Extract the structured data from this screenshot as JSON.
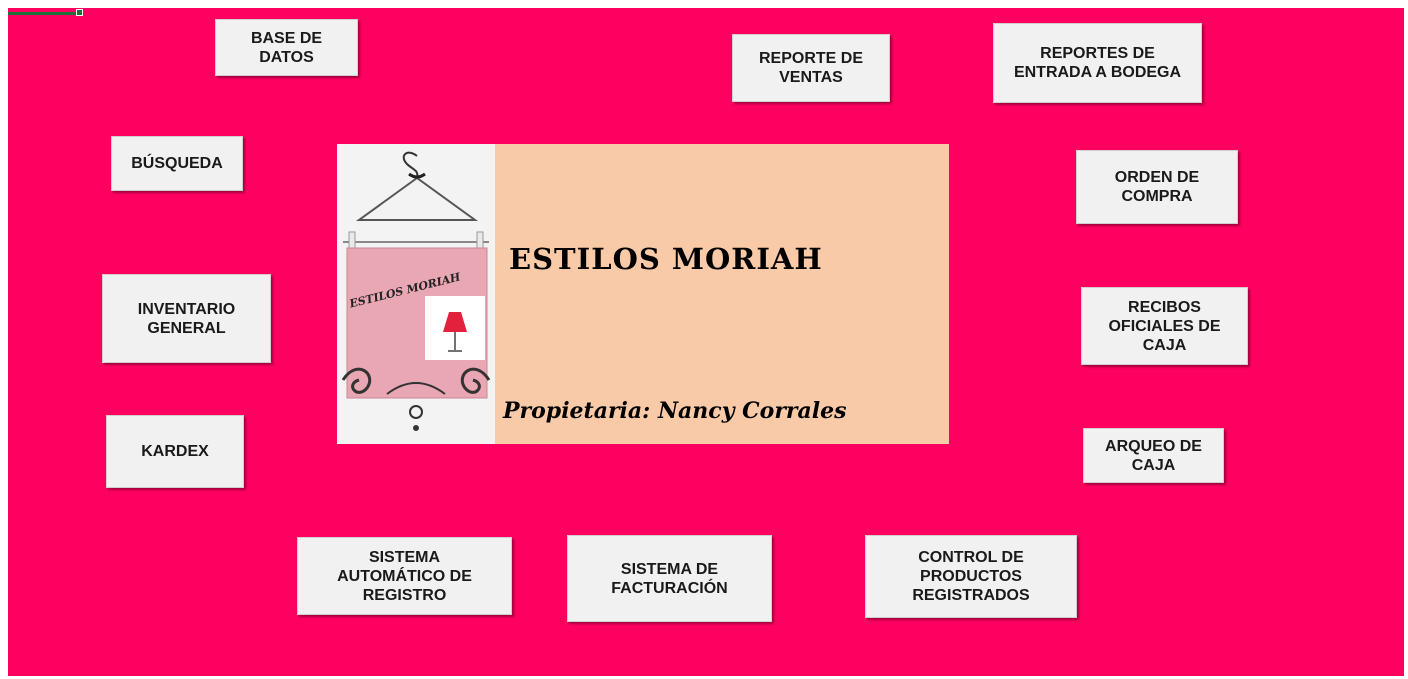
{
  "banner": {
    "title": "ESTILOS MORIAH",
    "owner": "Propietaria: Nancy Corrales",
    "logo_text": "ESTILOS MORIAH"
  },
  "buttons": {
    "base_datos": "BASE DE\nDATOS",
    "busqueda": "BÚSQUEDA",
    "inventario_general": "INVENTARIO\nGENERAL",
    "kardex": "KARDEX",
    "sistema_automatico": "SISTEMA\nAUTOMÁTICO DE\nREGISTRO",
    "sistema_facturacion": "SISTEMA DE\nFACTURACIÓN",
    "control_productos": "CONTROL DE\nPRODUCTOS\nREGISTRADOS",
    "reporte_ventas": "REPORTE DE\nVENTAS",
    "reportes_bodega": "REPORTES DE\nENTRADA A BODEGA",
    "orden_compra": "ORDEN DE\nCOMPRA",
    "recibos_oficiales": "RECIBOS\nOFICIALES DE\nCAJA",
    "arqueo_caja": "ARQUEO DE\nCAJA"
  },
  "colors": {
    "background": "#fe0060",
    "banner": "#f8caa8",
    "button": "#f1f1f1"
  }
}
